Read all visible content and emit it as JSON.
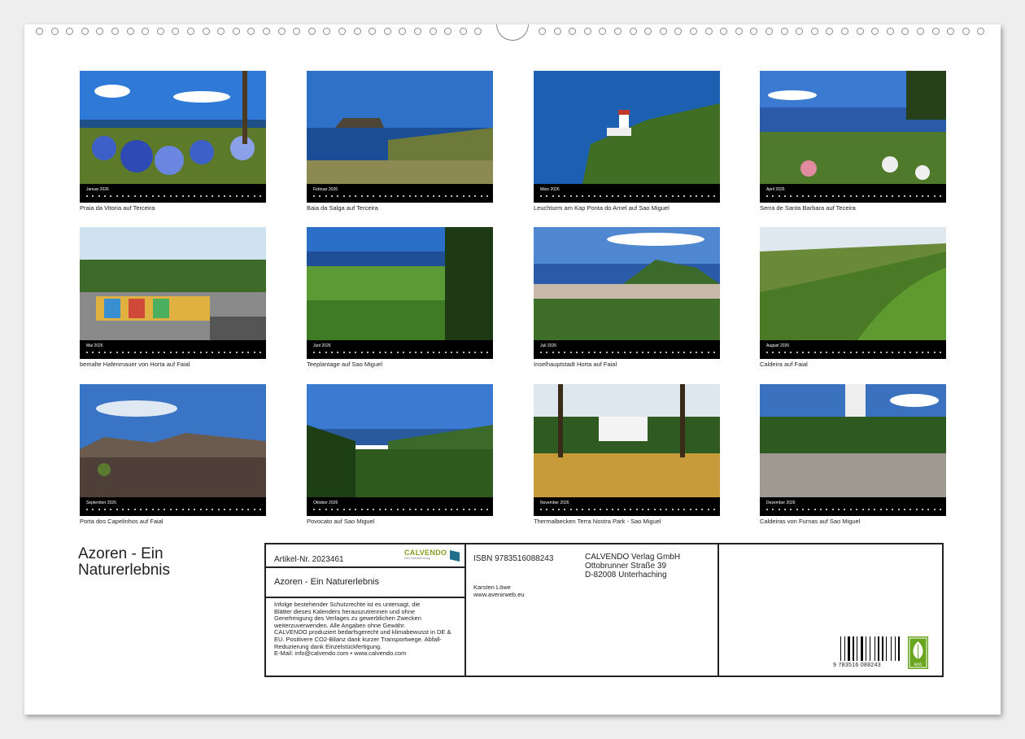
{
  "title_lines": [
    "Azoren - Ein",
    "Naturerlebnis"
  ],
  "months": [
    {
      "label": "Januar 2026",
      "caption": "Praia da Vitoria auf Terceira"
    },
    {
      "label": "Februar 2026",
      "caption": "Baia da Salga auf Terceira"
    },
    {
      "label": "März 2026",
      "caption": "Leuchturm am Kap Ponta do Arnel auf Sao Miguel"
    },
    {
      "label": "April 2026",
      "caption": "Serra de Santa Barbara auf Teceira"
    },
    {
      "label": "Mai 2026",
      "caption": "bemalte Hafenmauer von Horta auf Faial"
    },
    {
      "label": "Juni 2026",
      "caption": "Teeplantage auf Sao Miguel"
    },
    {
      "label": "Juli 2026",
      "caption": "Inselhauptstadt Horta auf Faial"
    },
    {
      "label": "August 2026",
      "caption": "Caldeira auf Faial"
    },
    {
      "label": "September 2026",
      "caption": "Porta dos Capelinhos auf Faial"
    },
    {
      "label": "Oktober 2026",
      "caption": "Povocato auf Sao Miguel"
    },
    {
      "label": "November 2026",
      "caption": "Thermalbecken Terra Nostra Park - Sao Miguel"
    },
    {
      "label": "Dezember 2026",
      "caption": "Caldeiras von Furnas auf Sao Miguel"
    }
  ],
  "info": {
    "article": "Artikel-Nr. 2023461",
    "logo_word": "CALVENDO",
    "logo_sub": "Dein Kalenderverlag",
    "product_title": "Azoren - Ein Naturerlebnis",
    "notice_lines": [
      "Infolge bestehender Schutzrechte ist es untersagt, die",
      "Blätter dieses Kalenders herauszutrennen und ohne",
      "Genehmigung des Verlages zu gewerblichen Zwecken",
      "weiterzuverwenden. Alle Angaben ohne Gewähr.",
      "CALVENDO produziert bedarfsgerecht und klimabewusst in DE &",
      "EU. Positivere CO2-Bilanz dank kurzer Transportwege. Abfall-",
      "Reduzierung dank Einzelstückfertigung.",
      "E-Mail: info@calvendo.com • www.calvendo.com"
    ],
    "isbn": "ISBN 9783516088243",
    "publisher_lines": [
      "CALVENDO Verlag GmbH",
      "Ottobrunner Straße 39",
      "D-82008 Unterhaching"
    ],
    "author": "Karsten Löwe",
    "author_web": "www.avenirweb.eu",
    "barcode_number": "9 783516 088243",
    "eco_label": "eco"
  }
}
